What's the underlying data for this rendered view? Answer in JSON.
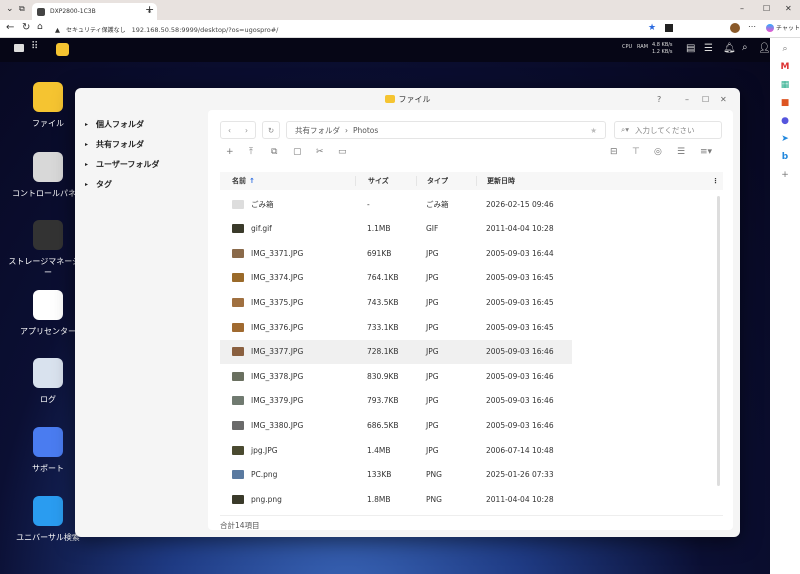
{
  "browser": {
    "tab_title": "DXP2800-1C3B",
    "security_label": "セキュリティ保護なし",
    "url": "192.168.50.58:9999/desktop/?os=ugospro#/",
    "copilot_label": "チャット"
  },
  "topbar": {
    "net_up": "4.8 KB/s",
    "net_down": "1.2 KB/s",
    "cpu_label": "CPU",
    "ram_label": "RAM"
  },
  "desktop_icons": [
    {
      "label": "ファイル",
      "color": "#f5c431"
    },
    {
      "label": "コントロールパネル",
      "color": "#d8d8d8"
    },
    {
      "label": "ストレージマネージャー",
      "color": "#333333"
    },
    {
      "label": "アプリセンター",
      "color": "#ffffff"
    },
    {
      "label": "ログ",
      "color": "#d9e2ee"
    },
    {
      "label": "サポート",
      "color": "#4a7cf0"
    },
    {
      "label": "ユニバーサル検索",
      "color": "#2a9cf0"
    }
  ],
  "window": {
    "title": "ファイル",
    "nav": [
      "個人フォルダ",
      "共有フォルダ",
      "ユーザーフォルダ",
      "タグ"
    ],
    "breadcrumb": [
      "共有フォルダ",
      "Photos"
    ],
    "search_placeholder": "入力してください",
    "columns": {
      "name": "名前",
      "size": "サイズ",
      "type": "タイプ",
      "modified": "更新日時"
    },
    "files": [
      {
        "name": "ごみ箱",
        "size": "-",
        "type": "ごみ箱",
        "modified": "2026-02-15 09:46",
        "thumb": "#dddddd"
      },
      {
        "name": "gif.gif",
        "size": "1.1MB",
        "type": "GIF",
        "modified": "2011-04-04 10:28",
        "thumb": "#3a3a2a"
      },
      {
        "name": "IMG_3371.JPG",
        "size": "691KB",
        "type": "JPG",
        "modified": "2005-09-03 16:44",
        "thumb": "#8a6a4a"
      },
      {
        "name": "IMG_3374.JPG",
        "size": "764.1KB",
        "type": "JPG",
        "modified": "2005-09-03 16:45",
        "thumb": "#9a6a2a"
      },
      {
        "name": "IMG_3375.JPG",
        "size": "743.5KB",
        "type": "JPG",
        "modified": "2005-09-03 16:45",
        "thumb": "#a07040"
      },
      {
        "name": "IMG_3376.JPG",
        "size": "733.1KB",
        "type": "JPG",
        "modified": "2005-09-03 16:45",
        "thumb": "#a06a30"
      },
      {
        "name": "IMG_3377.JPG",
        "size": "728.1KB",
        "type": "JPG",
        "modified": "2005-09-03 16:46",
        "thumb": "#8a6040",
        "selected": true
      },
      {
        "name": "IMG_3378.JPG",
        "size": "830.9KB",
        "type": "JPG",
        "modified": "2005-09-03 16:46",
        "thumb": "#6a7060"
      },
      {
        "name": "IMG_3379.JPG",
        "size": "793.7KB",
        "type": "JPG",
        "modified": "2005-09-03 16:46",
        "thumb": "#707a70"
      },
      {
        "name": "IMG_3380.JPG",
        "size": "686.5KB",
        "type": "JPG",
        "modified": "2005-09-03 16:46",
        "thumb": "#6a6a6a"
      },
      {
        "name": "jpg.JPG",
        "size": "1.4MB",
        "type": "JPG",
        "modified": "2006-07-14 10:48",
        "thumb": "#4a4a30"
      },
      {
        "name": "PC.png",
        "size": "133KB",
        "type": "PNG",
        "modified": "2025-01-26 07:33",
        "thumb": "#5a7aa0"
      },
      {
        "name": "png.png",
        "size": "1.8MB",
        "type": "PNG",
        "modified": "2011-04-04 10:28",
        "thumb": "#3a3a2a"
      }
    ],
    "footer": "合計14項目"
  }
}
